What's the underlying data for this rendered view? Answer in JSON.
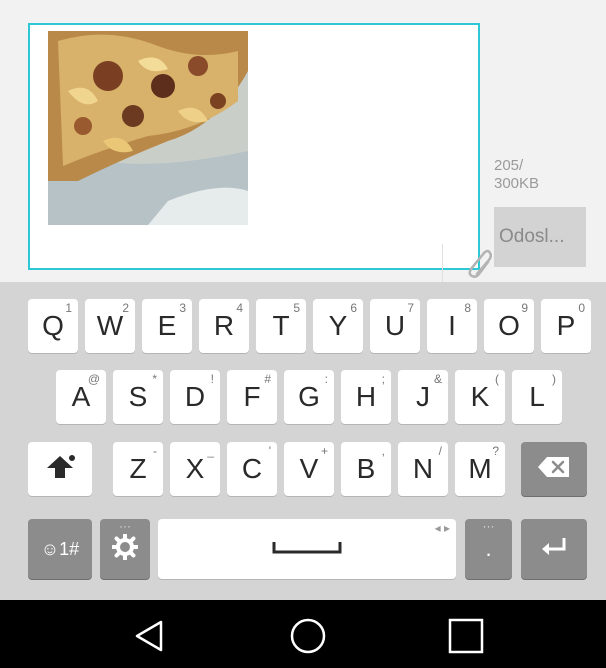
{
  "compose": {
    "size_label": "205/\n300KB",
    "send_label": "Odosl..."
  },
  "keyboard": {
    "row1": [
      {
        "label": "Q",
        "sub": "1"
      },
      {
        "label": "W",
        "sub": "2"
      },
      {
        "label": "E",
        "sub": "3"
      },
      {
        "label": "R",
        "sub": "4"
      },
      {
        "label": "T",
        "sub": "5"
      },
      {
        "label": "Y",
        "sub": "6"
      },
      {
        "label": "U",
        "sub": "7"
      },
      {
        "label": "I",
        "sub": "8"
      },
      {
        "label": "O",
        "sub": "9"
      },
      {
        "label": "P",
        "sub": "0"
      }
    ],
    "row2": [
      {
        "label": "A",
        "sub": "@"
      },
      {
        "label": "S",
        "sub": "*"
      },
      {
        "label": "D",
        "sub": "!"
      },
      {
        "label": "F",
        "sub": "#"
      },
      {
        "label": "G",
        "sub": ":"
      },
      {
        "label": "H",
        "sub": ";"
      },
      {
        "label": "J",
        "sub": "&"
      },
      {
        "label": "K",
        "sub": "("
      },
      {
        "label": "L",
        "sub": ")"
      }
    ],
    "row3": [
      {
        "label": "Z",
        "sub": "-"
      },
      {
        "label": "X",
        "sub": "_"
      },
      {
        "label": "C",
        "sub": "'"
      },
      {
        "label": "V",
        "sub": "+"
      },
      {
        "label": "B",
        "sub": ","
      },
      {
        "label": "N",
        "sub": "/"
      },
      {
        "label": "M",
        "sub": "?"
      }
    ],
    "symbols_label": "☺1#",
    "period_label": "."
  },
  "icons": {
    "attach": "paperclip-icon",
    "shift": "shift-icon",
    "backspace": "backspace-icon",
    "settings": "gear-icon",
    "space": "spacebar-icon",
    "enter": "enter-icon",
    "back": "back-triangle-icon",
    "home": "home-circle-icon",
    "recents": "recents-square-icon"
  }
}
